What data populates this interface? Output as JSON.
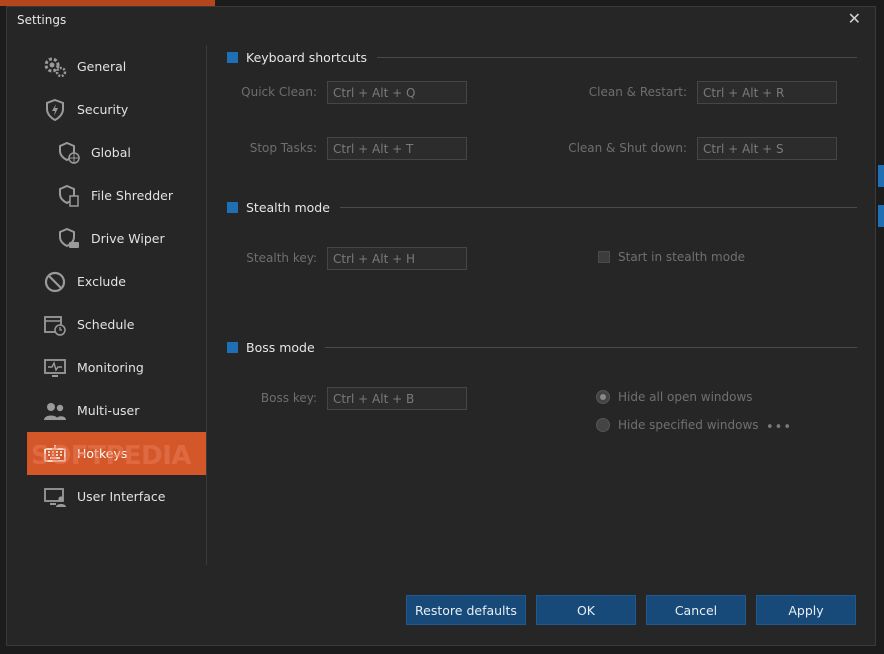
{
  "window": {
    "title": "Settings",
    "close_glyph": "✕"
  },
  "sidebar": {
    "items": [
      {
        "label": "General",
        "icon": "gears-icon"
      },
      {
        "label": "Security",
        "icon": "shield-bolt-icon"
      },
      {
        "label": "Global",
        "icon": "shield-globe-icon"
      },
      {
        "label": "File Shredder",
        "icon": "shield-file-icon"
      },
      {
        "label": "Drive Wiper",
        "icon": "shield-drive-icon"
      },
      {
        "label": "Exclude",
        "icon": "no-entry-icon"
      },
      {
        "label": "Schedule",
        "icon": "calendar-clock-icon"
      },
      {
        "label": "Monitoring",
        "icon": "monitor-pulse-icon"
      },
      {
        "label": "Multi-user",
        "icon": "users-icon"
      },
      {
        "label": "Hotkeys",
        "icon": "keyboard-icon"
      },
      {
        "label": "User Interface",
        "icon": "monitor-user-icon"
      }
    ],
    "active": "Hotkeys"
  },
  "watermark": "SOFTPEDIA",
  "sections": {
    "keyboard": {
      "title": "Keyboard shortcuts",
      "quick_clean": {
        "label": "Quick Clean:",
        "value": "Ctrl + Alt + Q"
      },
      "clean_restart": {
        "label": "Clean & Restart:",
        "value": "Ctrl + Alt + R"
      },
      "stop_tasks": {
        "label": "Stop Tasks:",
        "value": "Ctrl + Alt + T"
      },
      "clean_shutdown": {
        "label": "Clean & Shut down:",
        "value": "Ctrl + Alt + S"
      }
    },
    "stealth": {
      "title": "Stealth mode",
      "stealth_key": {
        "label": "Stealth key:",
        "value": "Ctrl + Alt + H"
      },
      "start_in_stealth": {
        "label": "Start in stealth mode",
        "checked": false
      }
    },
    "boss": {
      "title": "Boss mode",
      "boss_key": {
        "label": "Boss key:",
        "value": "Ctrl + Alt + B"
      },
      "hide_all": {
        "label": "Hide all open windows",
        "selected": true
      },
      "hide_specified": {
        "label": "Hide specified windows",
        "selected": false
      },
      "more": "•••"
    }
  },
  "buttons": {
    "restore": "Restore defaults",
    "ok": "OK",
    "cancel": "Cancel",
    "apply": "Apply"
  },
  "colors": {
    "accent": "#1f6fb5",
    "active_item": "#d4572a",
    "button": "#174a78"
  }
}
